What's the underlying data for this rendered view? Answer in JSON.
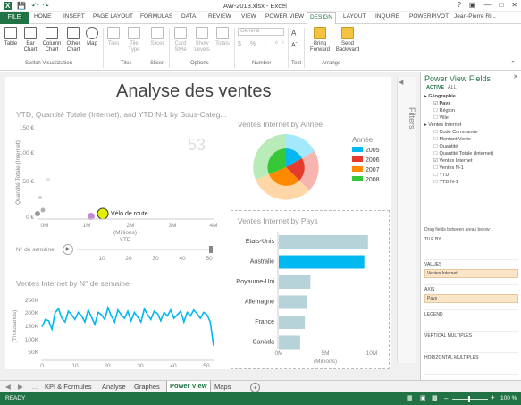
{
  "app": {
    "title": "AW-2013.xlsx - Excel",
    "user": "Jean-Pierre Ri..."
  },
  "tabs": [
    "FILE",
    "HOME",
    "INSERT",
    "PAGE LAYOUT",
    "FORMULAS",
    "DATA",
    "REVIEW",
    "VIEW",
    "POWER VIEW",
    "DESIGN",
    "LAYOUT",
    "INQUIRE",
    "POWERPIVOT"
  ],
  "ribbon": {
    "switch": [
      "Table",
      "Bar Chart",
      "Column Chart",
      "Other Chart",
      "Map"
    ],
    "switch_group": "Switch Visualization",
    "tiles": [
      "Tiles",
      "Tile Type"
    ],
    "tiles_group": "Tiles",
    "slicer": "Slicer",
    "slicer_group": "Slicer",
    "options": [
      "Card Style",
      "Show Levels",
      "Totals"
    ],
    "options_group": "Options",
    "number_format": "General",
    "number_group": "Number",
    "text_group": "Text",
    "arrange": [
      "Bring Forward",
      "Send Backward"
    ],
    "arrange_group": "Arrange"
  },
  "report": {
    "title": "Analyse des ventes"
  },
  "scatter": {
    "title": "YTD, Quantité Totale (Internet), and YTD N-1 by Sous-Catég...",
    "ylabel": "Quantité Totale (Internet)",
    "xlabel": "YTD",
    "xunit": "(Millions)",
    "yticks": [
      "150 €",
      "100 €",
      "50 €",
      "0 €"
    ],
    "xticks": [
      "0M",
      "1M",
      "2M",
      "3M",
      "4M"
    ],
    "big_number": "53",
    "point_label": "Vélo de route"
  },
  "play_axis": {
    "label": "N° de semaine",
    "ticks": [
      "10",
      "20",
      "30",
      "40",
      "50"
    ]
  },
  "line_chart": {
    "title": "Ventes Internet by N° de semaine",
    "ylabel": "(Thousands)",
    "yticks": [
      "250K",
      "200K",
      "150K",
      "100K",
      "50K"
    ],
    "xticks": [
      "0",
      "10",
      "20",
      "30",
      "40",
      "50"
    ]
  },
  "donut": {
    "title": "Ventes Internet by Année",
    "legend_title": "Année",
    "legend": [
      {
        "label": "2005",
        "color": "#01B8F0"
      },
      {
        "label": "2006",
        "color": "#E63A2C"
      },
      {
        "label": "2007",
        "color": "#FF8A00"
      },
      {
        "label": "2008",
        "color": "#37C839"
      }
    ]
  },
  "bar_chart": {
    "title": "Ventes Internet by Pays",
    "categories": [
      "États-Unis",
      "Australie",
      "Royaume-Uni",
      "Allemagne",
      "France",
      "Canada"
    ],
    "values": [
      9.6,
      9.2,
      3.4,
      3.0,
      2.8,
      2.3
    ],
    "xticks": [
      "0M",
      "5M",
      "10M"
    ],
    "xunit": "(Millions)"
  },
  "chart_data": [
    {
      "type": "bar",
      "title": "Ventes Internet by Pays",
      "categories": [
        "États-Unis",
        "Australie",
        "Royaume-Uni",
        "Allemagne",
        "France",
        "Canada"
      ],
      "series": [
        {
          "values": [
            9.6,
            9.2,
            3.4,
            3.0,
            2.8,
            2.3
          ]
        }
      ],
      "xlabel": "(Millions)",
      "xlim": [
        0,
        10
      ]
    },
    {
      "type": "line",
      "title": "Ventes Internet by N° de semaine",
      "x": [
        1,
        2,
        3,
        4,
        5,
        6,
        7,
        8,
        9,
        10,
        11,
        12,
        13,
        14,
        15,
        16,
        17,
        18,
        19,
        20,
        21,
        22,
        23,
        24,
        25,
        26,
        27,
        28,
        29,
        30,
        31,
        32,
        33,
        34,
        35,
        36,
        37,
        38,
        39,
        40,
        41,
        42,
        43,
        44,
        45,
        46,
        47,
        48,
        49,
        50,
        51,
        52,
        53
      ],
      "series": [
        {
          "values": [
            140,
            170,
            165,
            130,
            200,
            215,
            175,
            160,
            205,
            190,
            170,
            200,
            185,
            160,
            210,
            180,
            150,
            200,
            190,
            170,
            220,
            185,
            160,
            210,
            190,
            175,
            205,
            165,
            200,
            180,
            160,
            215,
            190,
            170,
            205,
            195,
            165,
            200,
            185,
            210,
            175,
            190,
            205,
            160,
            200,
            185,
            210,
            195,
            175,
            200,
            190,
            160,
            60
          ]
        }
      ],
      "ylabel": "(Thousands)",
      "ylim": [
        0,
        275
      ]
    }
  ],
  "panel": {
    "title": "Power View Fields",
    "tabs": [
      "ACTIVE",
      "ALL"
    ],
    "fields": [
      {
        "label": "Géographie",
        "bold": true,
        "level": 0,
        "checked": null
      },
      {
        "label": "Pays",
        "level": 1,
        "checked": true,
        "bold": true
      },
      {
        "label": "Région",
        "level": 1,
        "checked": false
      },
      {
        "label": "Ville",
        "level": 1,
        "checked": false
      },
      {
        "label": "Ventes Internet",
        "level": 0,
        "checked": null
      },
      {
        "label": "Code Commande",
        "level": 1,
        "checked": false
      },
      {
        "label": "Montant Vente",
        "level": 1,
        "checked": false
      },
      {
        "label": "Quantité",
        "level": 1,
        "checked": false
      },
      {
        "label": "Quantité Totale (Internet)",
        "level": 1,
        "checked": false
      },
      {
        "label": "Ventes Internet",
        "level": 1,
        "checked": true
      },
      {
        "label": "Ventes N-1",
        "level": 1,
        "checked": false
      },
      {
        "label": "YTD",
        "level": 1,
        "checked": false
      },
      {
        "label": "YTD N-1",
        "level": 1,
        "checked": false
      }
    ],
    "drag_hint": "Drag fields between areas below:",
    "areas": [
      {
        "label": "TILE BY",
        "value": ""
      },
      {
        "label": "VALUES",
        "value": "Ventes Internet"
      },
      {
        "label": "AXIS",
        "value": "Pays"
      },
      {
        "label": "LEGEND",
        "value": ""
      },
      {
        "label": "VERTICAL MULTIPLES",
        "value": ""
      },
      {
        "label": "HORIZONTAL MULTIPLES",
        "value": ""
      }
    ]
  },
  "filters_label": "Filters",
  "sheets": [
    "KPI & Formules",
    "Analyse",
    "Graphes",
    "Power View",
    "Maps"
  ],
  "active_sheet": "Power View",
  "status": {
    "left": "READY",
    "zoom": "100 %"
  }
}
